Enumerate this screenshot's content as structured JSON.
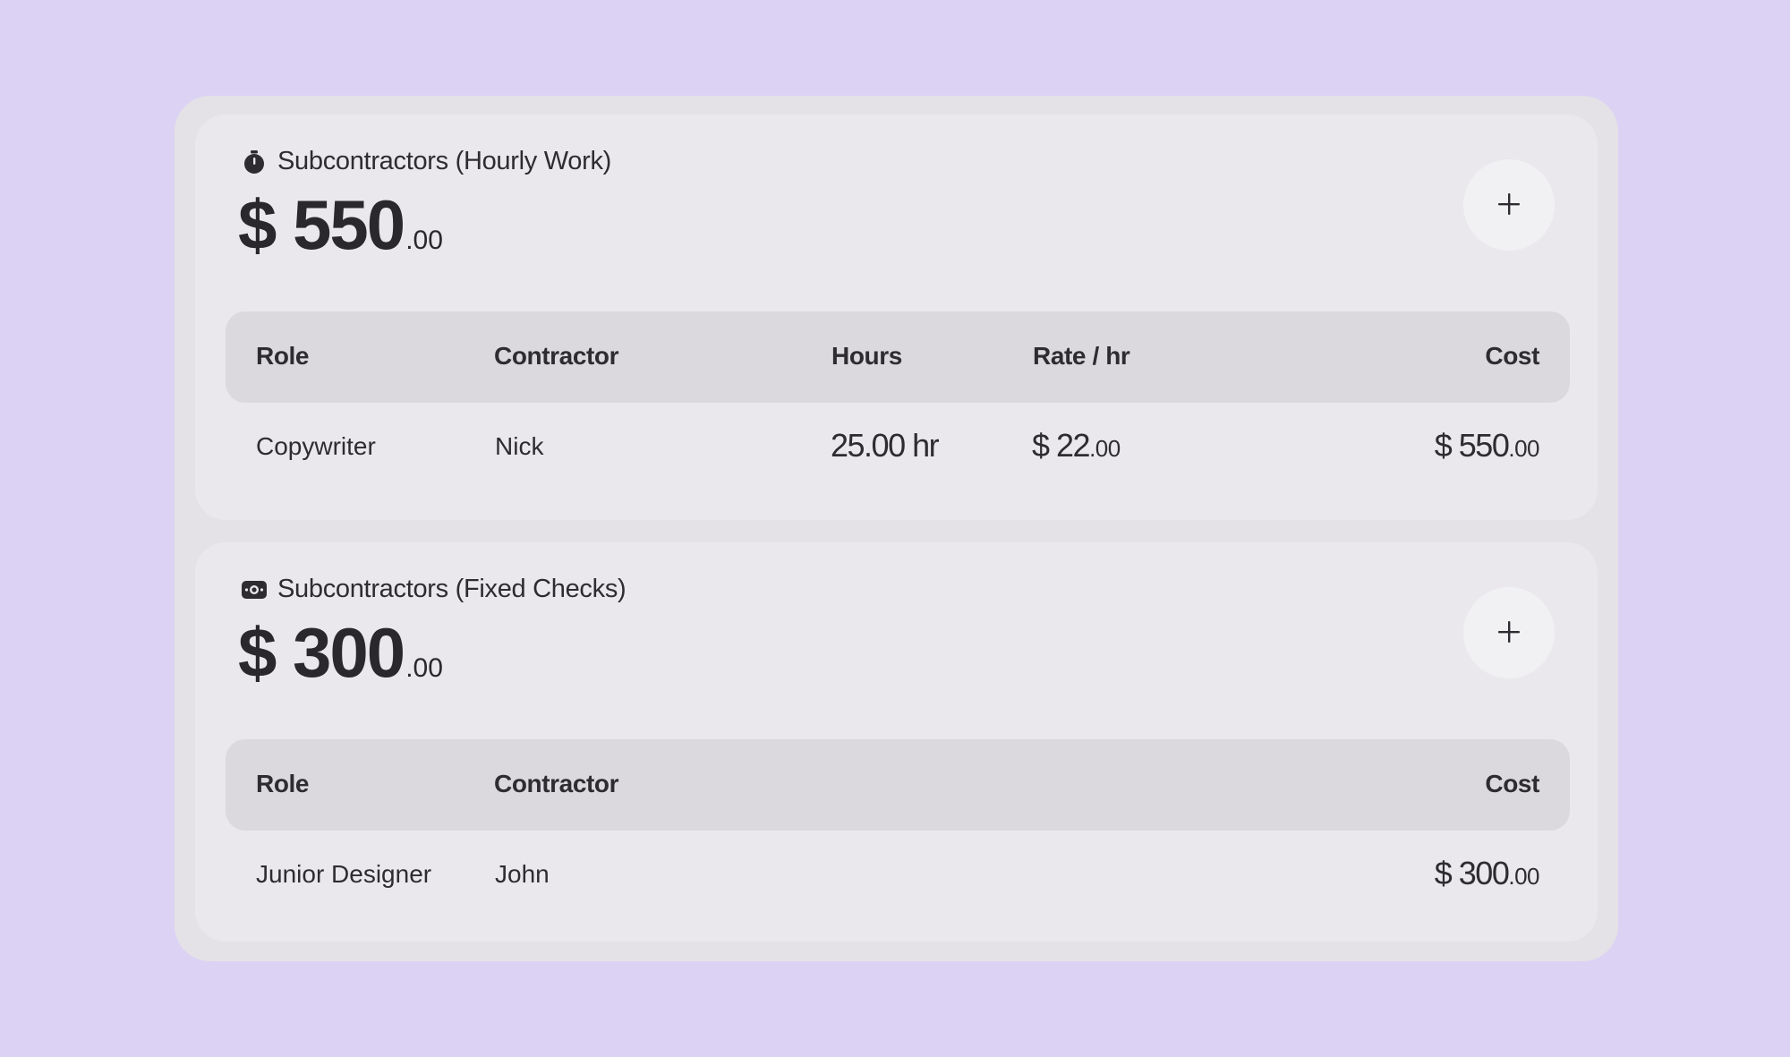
{
  "sections": {
    "hourly": {
      "title": "Subcontractors (Hourly Work)",
      "icon": "stopwatch-icon",
      "total_main": "$ 550",
      "total_cents": ".00",
      "columns": {
        "role": "Role",
        "contractor": "Contractor",
        "hours": "Hours",
        "rate": "Rate / hr",
        "cost": "Cost"
      },
      "rows": [
        {
          "role": "Copywriter",
          "contractor": "Nick",
          "hours": "25.00 hr",
          "rate_main": "$ 22",
          "rate_cents": ".00",
          "cost_main": "$ 550",
          "cost_cents": ".00"
        }
      ]
    },
    "fixed": {
      "title": "Subcontractors (Fixed Checks)",
      "icon": "banknote-icon",
      "total_main": "$ 300",
      "total_cents": ".00",
      "columns": {
        "role": "Role",
        "contractor": "Contractor",
        "cost": "Cost"
      },
      "rows": [
        {
          "role": "Junior Designer",
          "contractor": "John",
          "cost_main": "$ 300",
          "cost_cents": ".00"
        }
      ]
    }
  },
  "colors": {
    "background": "#dcd3f4",
    "card": "#e4e2e6",
    "section": "#eae8ec",
    "table_header": "#dbd9dd",
    "text": "#2e2c31"
  }
}
